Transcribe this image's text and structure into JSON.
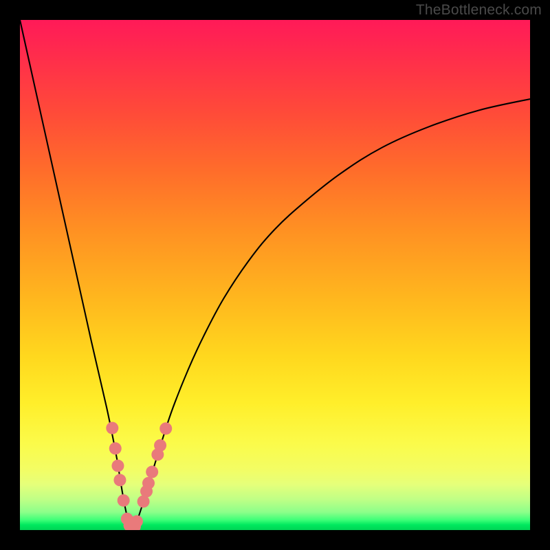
{
  "watermark": "TheBottleneck.com",
  "colors": {
    "curve": "#000000",
    "marker_fill": "#e97a7b",
    "marker_stroke": "#c95a5b"
  },
  "chart_data": {
    "type": "line",
    "title": "",
    "xlabel": "",
    "ylabel": "",
    "xlim": [
      0,
      100
    ],
    "ylim": [
      0,
      100
    ],
    "grid": false,
    "series": [
      {
        "name": "bottleneck-curve",
        "x": [
          0,
          2,
          4,
          6,
          8,
          10,
          12,
          14,
          15.5,
          17,
          18,
          19,
          19.6,
          20.2,
          20.8,
          21.3,
          21.7,
          22,
          22.4,
          23.2,
          24.4,
          26,
          28,
          30,
          33,
          36,
          40,
          45,
          50,
          56,
          63,
          71,
          80,
          90,
          100
        ],
        "y": [
          100,
          91,
          82,
          73,
          64,
          55,
          46,
          37,
          30.5,
          24,
          19.2,
          14,
          10.3,
          6.7,
          3.6,
          1.5,
          0.55,
          0.2,
          0.6,
          2.5,
          6.2,
          11.5,
          18,
          24,
          31.5,
          38,
          45.5,
          53,
          59,
          64.5,
          70,
          75,
          79,
          82.3,
          84.5
        ]
      }
    ],
    "markers": [
      {
        "x": 18.1,
        "y": 20.0
      },
      {
        "x": 18.7,
        "y": 16.0
      },
      {
        "x": 19.2,
        "y": 12.6
      },
      {
        "x": 19.6,
        "y": 9.8
      },
      {
        "x": 20.3,
        "y": 5.8
      },
      {
        "x": 21.0,
        "y": 2.2
      },
      {
        "x": 21.5,
        "y": 0.9
      },
      {
        "x": 22.0,
        "y": 0.3
      },
      {
        "x": 22.5,
        "y": 0.7
      },
      {
        "x": 22.9,
        "y": 1.7
      },
      {
        "x": 24.2,
        "y": 5.6
      },
      {
        "x": 24.8,
        "y": 7.6
      },
      {
        "x": 25.2,
        "y": 9.2
      },
      {
        "x": 25.9,
        "y": 11.4
      },
      {
        "x": 27.0,
        "y": 14.8
      },
      {
        "x": 27.5,
        "y": 16.6
      },
      {
        "x": 28.6,
        "y": 19.9
      }
    ]
  }
}
